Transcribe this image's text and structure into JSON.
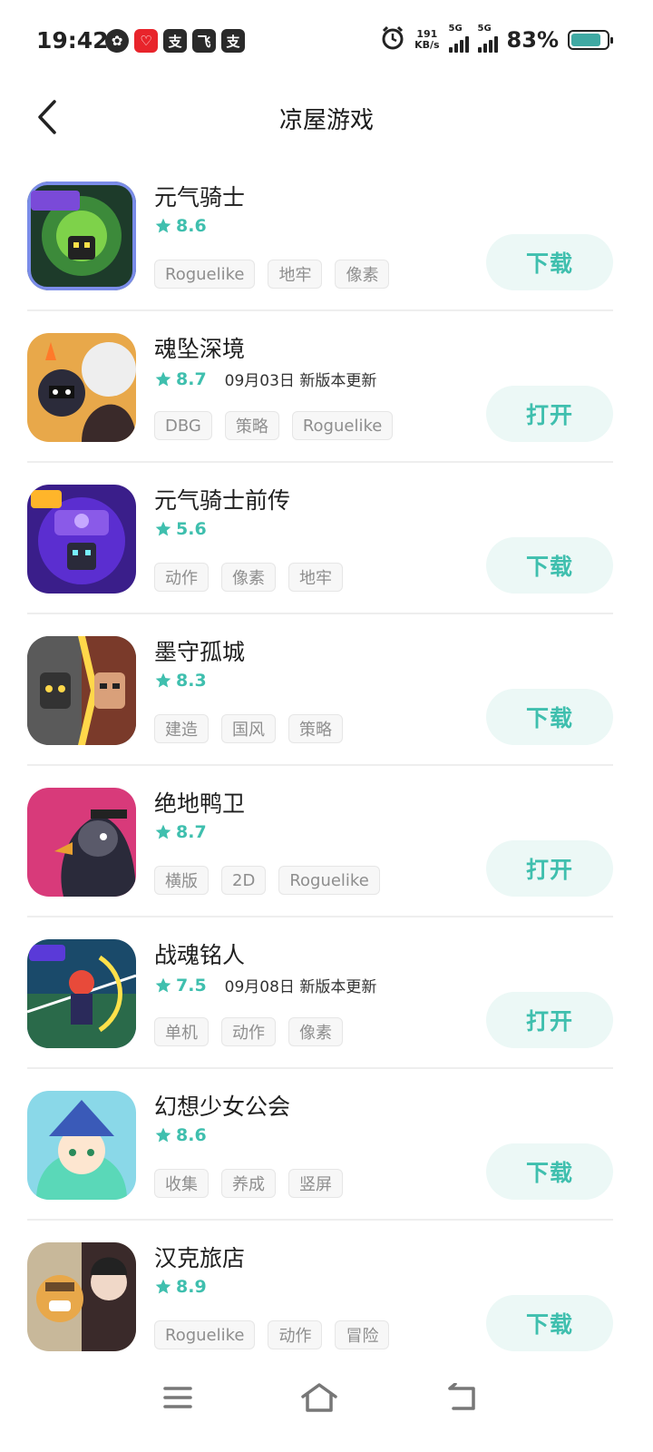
{
  "status_bar": {
    "time": "19:42",
    "app_badges": [
      "✿",
      "♡",
      "支",
      "飞",
      "支"
    ],
    "net_speed_value": "191",
    "net_speed_unit": "KB/s",
    "sim1_label": "5G",
    "sim2_label": "5G",
    "battery_pct": "83%",
    "battery_level": 0.83,
    "battery_color": "#3fa9a3"
  },
  "header": {
    "title": "凉屋游戏",
    "back_icon": "chevron-left-icon"
  },
  "colors": {
    "accent": "#3fbfae",
    "button_bg": "#ecf8f6",
    "tag_text": "#8e8e8e"
  },
  "games": [
    {
      "name": "元气骑士",
      "rating": "8.6",
      "update": "",
      "tags": [
        "Roguelike",
        "地牢",
        "像素"
      ],
      "action": "下载"
    },
    {
      "name": "魂坠深境",
      "rating": "8.7",
      "update": "09月03日 新版本更新",
      "tags": [
        "DBG",
        "策略",
        "Roguelike"
      ],
      "action": "打开"
    },
    {
      "name": "元气骑士前传",
      "rating": "5.6",
      "update": "",
      "tags": [
        "动作",
        "像素",
        "地牢"
      ],
      "action": "下载"
    },
    {
      "name": "墨守孤城",
      "rating": "8.3",
      "update": "",
      "tags": [
        "建造",
        "国风",
        "策略"
      ],
      "action": "下载"
    },
    {
      "name": "绝地鸭卫",
      "rating": "8.7",
      "update": "",
      "tags": [
        "横版",
        "2D",
        "Roguelike"
      ],
      "action": "打开"
    },
    {
      "name": "战魂铭人",
      "rating": "7.5",
      "update": "09月08日 新版本更新",
      "tags": [
        "单机",
        "动作",
        "像素"
      ],
      "action": "打开"
    },
    {
      "name": "幻想少女公会",
      "rating": "8.6",
      "update": "",
      "tags": [
        "收集",
        "养成",
        "竖屏"
      ],
      "action": "下载"
    },
    {
      "name": "汉克旅店",
      "rating": "8.9",
      "update": "",
      "tags": [
        "Roguelike",
        "动作",
        "冒险"
      ],
      "action": "下载"
    }
  ],
  "nav": {
    "menu_icon": "menu-icon",
    "home_icon": "home-icon",
    "back_icon": "back-icon"
  }
}
